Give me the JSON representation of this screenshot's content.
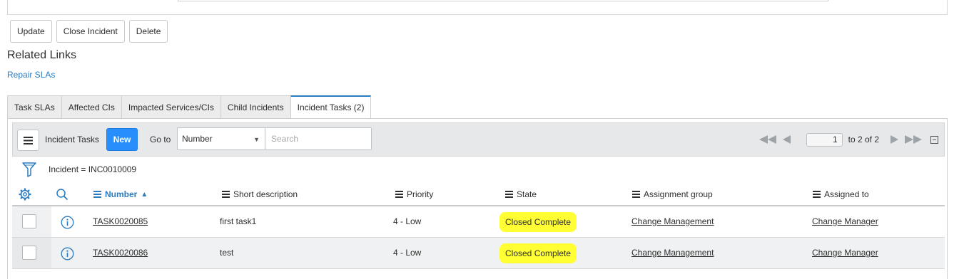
{
  "actions": {
    "update": "Update",
    "close_incident": "Close Incident",
    "delete": "Delete"
  },
  "related_links": {
    "heading": "Related Links",
    "repair_slas": "Repair SLAs"
  },
  "tabs": [
    {
      "label": "Task SLAs"
    },
    {
      "label": "Affected CIs"
    },
    {
      "label": "Impacted Services/CIs"
    },
    {
      "label": "Child Incidents"
    },
    {
      "label": "Incident Tasks (2)"
    }
  ],
  "list": {
    "title": "Incident Tasks",
    "new_label": "New",
    "goto_label": "Go to",
    "goto_field": "Number",
    "search_placeholder": "Search",
    "page": "1",
    "range": "to 2 of 2",
    "filter": "Incident = INC0010009",
    "columns": {
      "number": "Number",
      "short_description": "Short description",
      "priority": "Priority",
      "state": "State",
      "assignment_group": "Assignment group",
      "assigned_to": "Assigned to"
    },
    "rows": [
      {
        "number": "TASK0020085",
        "short_description": "first task1",
        "priority": "4 - Low",
        "state": "Closed Complete",
        "assignment_group": "Change Management",
        "assigned_to": "Change Manager"
      },
      {
        "number": "TASK0020086",
        "short_description": "test",
        "priority": "4 - Low",
        "state": "Closed Complete",
        "assignment_group": "Change Management",
        "assigned_to": "Change Manager"
      }
    ]
  },
  "colors": {
    "accent": "#2b7bc0",
    "new_button": "#278efc",
    "highlight": "#ffff33"
  },
  "icons": {
    "list_menu": "hamburger-icon",
    "filter": "filter-icon",
    "settings": "gear-icon",
    "search": "search-icon",
    "row_info": "info-icon",
    "first": "first-page-icon",
    "prev": "prev-page-icon",
    "next": "next-page-icon",
    "last": "last-page-icon"
  }
}
